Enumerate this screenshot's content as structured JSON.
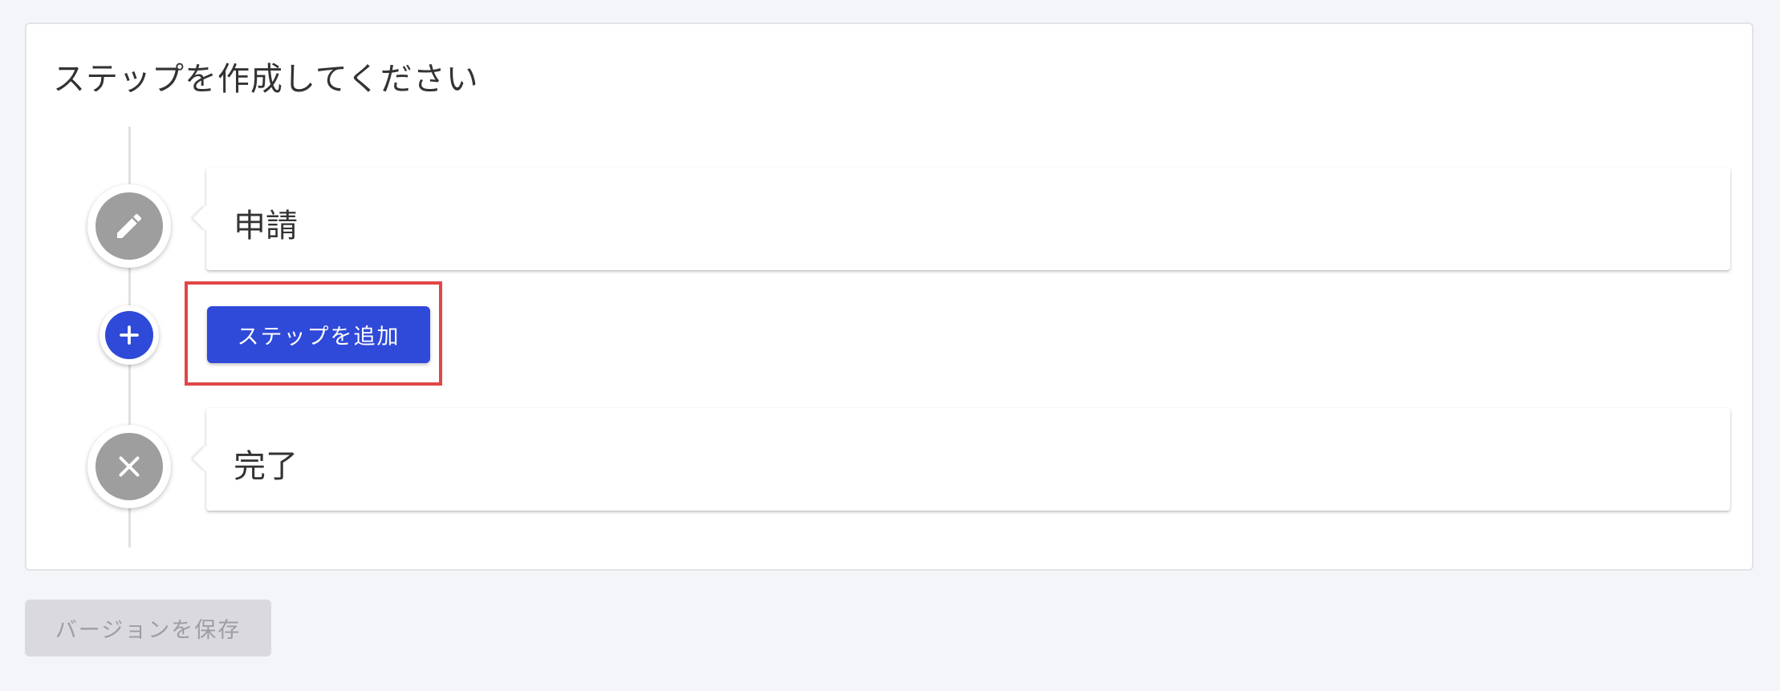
{
  "page": {
    "title": "ステップを作成してください"
  },
  "steps": [
    {
      "label": "申請",
      "icon": "pencil-icon"
    },
    {
      "label": "完了",
      "icon": "close-icon"
    }
  ],
  "add_step": {
    "label": "ステップを追加",
    "icon": "plus-icon"
  },
  "footer": {
    "save_label": "バージョンを保存"
  },
  "colors": {
    "accent": "#2f49d8",
    "node_gray": "#9e9e9e",
    "highlight": "#e14646",
    "disabled_bg": "#d9d9de",
    "disabled_text": "#9d9da3"
  }
}
